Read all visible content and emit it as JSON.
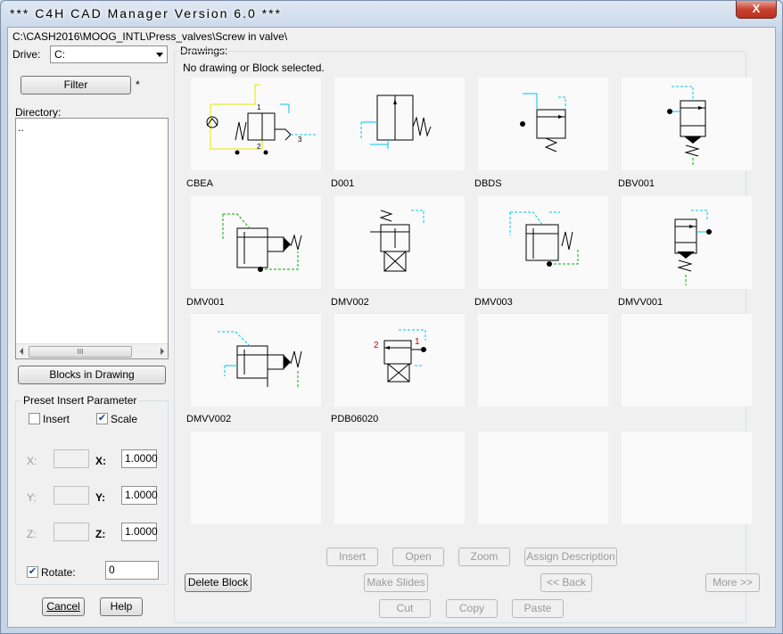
{
  "window": {
    "title": "*** C4H CAD Manager Version 6.0 ***",
    "close_label": "X"
  },
  "path": "C:\\CASH2016\\MOOG_INTL\\Press_valves\\Screw in valve\\",
  "drive": {
    "label": "Drive:",
    "value": "C:"
  },
  "filter": {
    "button": "Filter",
    "value": "*"
  },
  "directory": {
    "label": "Directory:",
    "items": [
      ".."
    ]
  },
  "blocks_button": "Blocks in Drawing",
  "preset": {
    "title": "Preset Insert Parameter",
    "insert_label": "Insert",
    "insert_checked": false,
    "scale_label": "Scale",
    "scale_checked": true,
    "x_label": "X:",
    "y_label": "Y:",
    "z_label": "Z:",
    "x_scale": "1.0000",
    "y_scale": "1.0000",
    "z_scale": "1.0000",
    "rotate_label": "Rotate:",
    "rotate_checked": true,
    "rotate_value": "0"
  },
  "bottom_left": {
    "cancel": "Cancel",
    "help": "Help"
  },
  "drawings": {
    "label": "Drawings:",
    "status": "No drawing or Block selected.",
    "items": [
      "CBEA",
      "D001",
      "DBDS",
      "DBV001",
      "DMV001",
      "DMV002",
      "DMV003",
      "DMVV001",
      "DMVV002",
      "PDB06020"
    ]
  },
  "actions": {
    "insert": "Insert",
    "open": "Open",
    "zoom": "Zoom",
    "assign": "Assign Description",
    "delete": "Delete Block",
    "make_slides": "Make Slides",
    "back": "<< Back",
    "more": "More >>",
    "cut": "Cut",
    "copy": "Copy",
    "paste": "Paste"
  },
  "colors": {
    "accent_cyan": "#00c8e0",
    "green": "#00b000",
    "red": "#cc0000",
    "yellow": "#e6e600"
  }
}
